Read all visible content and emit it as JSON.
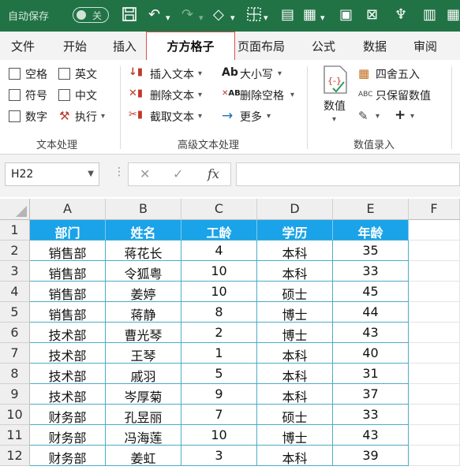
{
  "titlebar": {
    "autosave_label": "自动保存",
    "toggle_state": "关",
    "bg_color": "#217346"
  },
  "tabs": [
    {
      "label": "文件"
    },
    {
      "label": "开始"
    },
    {
      "label": "插入"
    },
    {
      "label": "方方格子",
      "active": true
    },
    {
      "label": "页面布局"
    },
    {
      "label": "公式"
    },
    {
      "label": "数据"
    },
    {
      "label": "审阅"
    }
  ],
  "ribbon": {
    "text_group": {
      "label": "文本处理",
      "options": [
        "空格",
        "英文",
        "符号",
        "中文",
        "数字"
      ],
      "execute_label": "执行"
    },
    "advanced_group": {
      "label": "高级文本处理",
      "insert_text": "插入文本",
      "delete_text": "删除文本",
      "extract_text": "截取文本",
      "case_label": "大小写",
      "delete_space": "删除空格",
      "more": "更多"
    },
    "entry_group": {
      "label": "数值录入",
      "value_label": "数值",
      "round_label": "四舍五入",
      "keep_value_label": "只保留数值"
    }
  },
  "formula_bar": {
    "name_box": "H22",
    "formula": ""
  },
  "sheet": {
    "columns": [
      "A",
      "B",
      "C",
      "D",
      "E",
      "F"
    ],
    "rows": [
      "1",
      "2",
      "3",
      "4",
      "5",
      "6",
      "7",
      "8",
      "9",
      "10",
      "11",
      "12"
    ],
    "header_color": "#1aa3e8",
    "border_color": "#4bacc6",
    "headers": [
      "部门",
      "姓名",
      "工龄",
      "学历",
      "年龄"
    ],
    "data": [
      [
        "销售部",
        "蒋花长",
        "4",
        "本科",
        "35"
      ],
      [
        "销售部",
        "令狐粤",
        "10",
        "本科",
        "33"
      ],
      [
        "销售部",
        "姜婷",
        "10",
        "硕士",
        "45"
      ],
      [
        "销售部",
        "蒋静",
        "8",
        "博士",
        "44"
      ],
      [
        "技术部",
        "曹光琴",
        "2",
        "博士",
        "43"
      ],
      [
        "技术部",
        "王琴",
        "1",
        "本科",
        "40"
      ],
      [
        "技术部",
        "戚羽",
        "5",
        "本科",
        "31"
      ],
      [
        "技术部",
        "岑厚菊",
        "9",
        "本科",
        "37"
      ],
      [
        "财务部",
        "孔昱丽",
        "7",
        "硕士",
        "33"
      ],
      [
        "财务部",
        "冯海莲",
        "10",
        "博士",
        "43"
      ],
      [
        "财务部",
        "姜虹",
        "3",
        "本科",
        "39"
      ]
    ]
  }
}
